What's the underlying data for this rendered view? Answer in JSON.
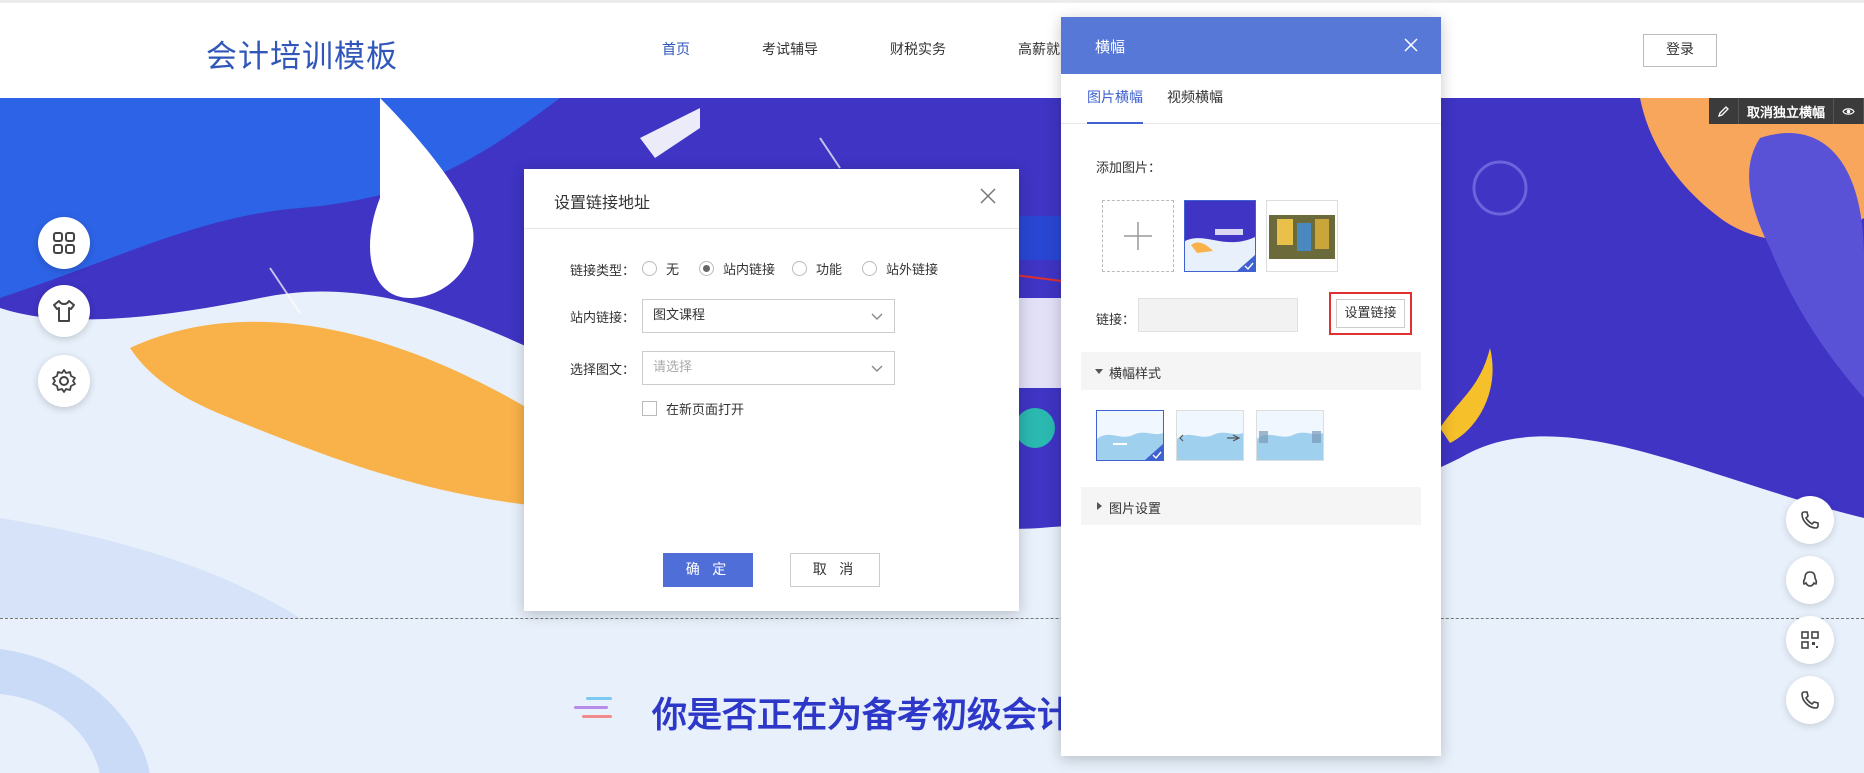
{
  "header": {
    "logo": "会计培训模板",
    "nav": [
      "首页",
      "考试辅导",
      "财税实务",
      "高薪就业"
    ],
    "login": "登录"
  },
  "toolbar": {
    "unlink_label": "取消独立横幅"
  },
  "lower": {
    "headline": "你是否正在为备考初级会计"
  },
  "dialog": {
    "title": "设置链接地址",
    "link_type_label": "链接类型：",
    "link_type_options": [
      "无",
      "站内链接",
      "功能",
      "站外链接"
    ],
    "link_type_selected": "站内链接",
    "site_link_label": "站内链接：",
    "site_link_value": "图文课程",
    "choose_article_label": "选择图文：",
    "choose_article_placeholder": "请选择",
    "new_page_label": "在新页面打开",
    "confirm": "确 定",
    "cancel": "取 消"
  },
  "panel": {
    "title": "横幅",
    "tabs": [
      "图片横幅",
      "视频横幅"
    ],
    "add_image_label": "添加图片：",
    "link_label": "链接：",
    "set_link_button": "设置链接",
    "banner_style_section": "横幅样式",
    "image_settings_section": "图片设置"
  },
  "colors": {
    "brand_blue": "#2f56b8",
    "panel_header": "#5878d8",
    "primary_button": "#4f6ed8",
    "highlight_red": "#e03030"
  }
}
